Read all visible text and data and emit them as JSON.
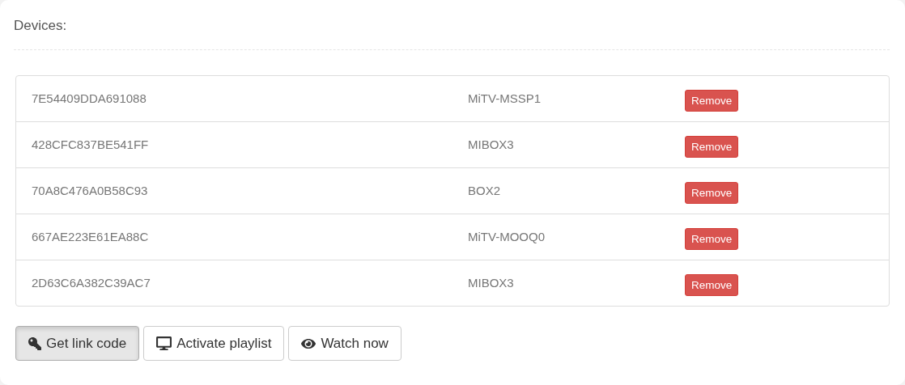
{
  "title": "Devices:",
  "devices": [
    {
      "id": "7E54409DDA691088",
      "model": "MiTV-MSSP1",
      "action": "Remove"
    },
    {
      "id": "428CFC837BE541FF",
      "model": "MIBOX3",
      "action": "Remove"
    },
    {
      "id": "70A8C476A0B58C93",
      "model": "BOX2",
      "action": "Remove"
    },
    {
      "id": "667AE223E61EA88C",
      "model": "MiTV-MOOQ0",
      "action": "Remove"
    },
    {
      "id": "2D63C6A382C39AC7",
      "model": "MIBOX3",
      "action": "Remove"
    }
  ],
  "buttons": [
    {
      "kind": "key",
      "label": "Get link code",
      "active": true
    },
    {
      "kind": "desktop",
      "label": "Activate playlist",
      "active": false
    },
    {
      "kind": "eye",
      "label": "Watch now",
      "active": false
    }
  ]
}
